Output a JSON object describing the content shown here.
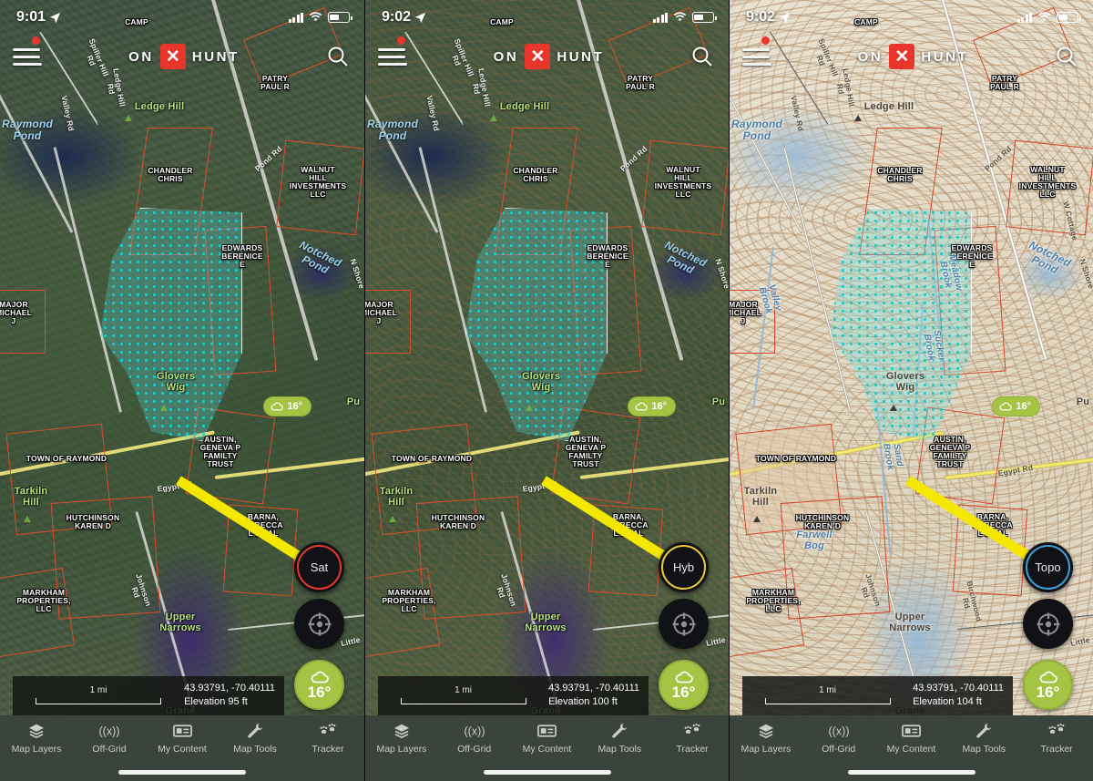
{
  "app": {
    "brand_left": "ON",
    "brand_right": "HUNT",
    "brand_x": "✕",
    "accent_red": "#e8372a"
  },
  "panels": [
    {
      "id": "satellite",
      "status": {
        "time": "9:01",
        "location_arrow": "➤"
      },
      "maptype": {
        "label": "Sat",
        "ring_color": "#e8372a"
      },
      "info": {
        "scale": "1 mi",
        "coords": "43.93791, -70.40111",
        "elevation": "Elevation 95 ft"
      },
      "weather": {
        "temp": "16°",
        "pill_temp": "16°",
        "icon": "cloud-icon"
      }
    },
    {
      "id": "hybrid",
      "status": {
        "time": "9:02",
        "location_arrow": "➤"
      },
      "maptype": {
        "label": "Hyb",
        "ring_color": "#e8c93a"
      },
      "info": {
        "scale": "1 mi",
        "coords": "43.93791, -70.40111",
        "elevation": "Elevation 100 ft"
      },
      "weather": {
        "temp": "16°",
        "pill_temp": "16°",
        "icon": "cloud-icon"
      }
    },
    {
      "id": "topo",
      "status": {
        "time": "9:02",
        "location_arrow": "➤"
      },
      "maptype": {
        "label": "Topo",
        "ring_color": "#3d9fd6"
      },
      "info": {
        "scale": "1 mi",
        "coords": "43.93791, -70.40111",
        "elevation": "Elevation 104 ft"
      },
      "weather": {
        "temp": "16°",
        "pill_temp": "16°",
        "icon": "cloud-icon"
      }
    }
  ],
  "tabbar": {
    "items": [
      {
        "label": "Map Layers",
        "icon": "layers-icon"
      },
      {
        "label": "Off-Grid",
        "icon": "broadcast-icon"
      },
      {
        "label": "My Content",
        "icon": "content-card-icon"
      },
      {
        "label": "Map Tools",
        "icon": "map-tools-icon"
      },
      {
        "label": "Tracker",
        "icon": "animal-tracks-icon"
      }
    ]
  },
  "map_labels": {
    "parcels": [
      "CAMP",
      "PATRY\nPAUL R",
      "CHANDLER\nCHRIS",
      "WALNUT\nHILL\nINVESTMENTS\nLLC",
      "EDWARDS\nBERENICE\nE",
      "MAJOR\nMICHAEL\nJ",
      "TOWN OF RAYMOND",
      "AUSTIN,\nGENEVA P\nFAMILTY\nTRUST",
      "HUTCHINSON\nKAREN D",
      "BARNA,\nREBECCA\nL ET AL",
      "MARKHAM\nPROPERTIES,\nLLC"
    ],
    "water": [
      "Raymond\nPond",
      "Notched\nPond",
      "Upper\nNarrows",
      "Meadow Brook",
      "Valley Brook",
      "Sucker Brook",
      "Sand Brook",
      "Farwell\nBog"
    ],
    "places": [
      "Ledge Hill",
      "Glovers\nWig",
      "Tarkiln\nHill",
      "Grane",
      "Pu"
    ],
    "roads": [
      "Spiller Hill Rd",
      "Valley Rd",
      "Pond Rd",
      "Ledge Hill Rd",
      "Egypt Rd",
      "N Shore",
      "Johnson Rd",
      "Birchwood Rd",
      "W Cottage",
      "Little"
    ]
  }
}
